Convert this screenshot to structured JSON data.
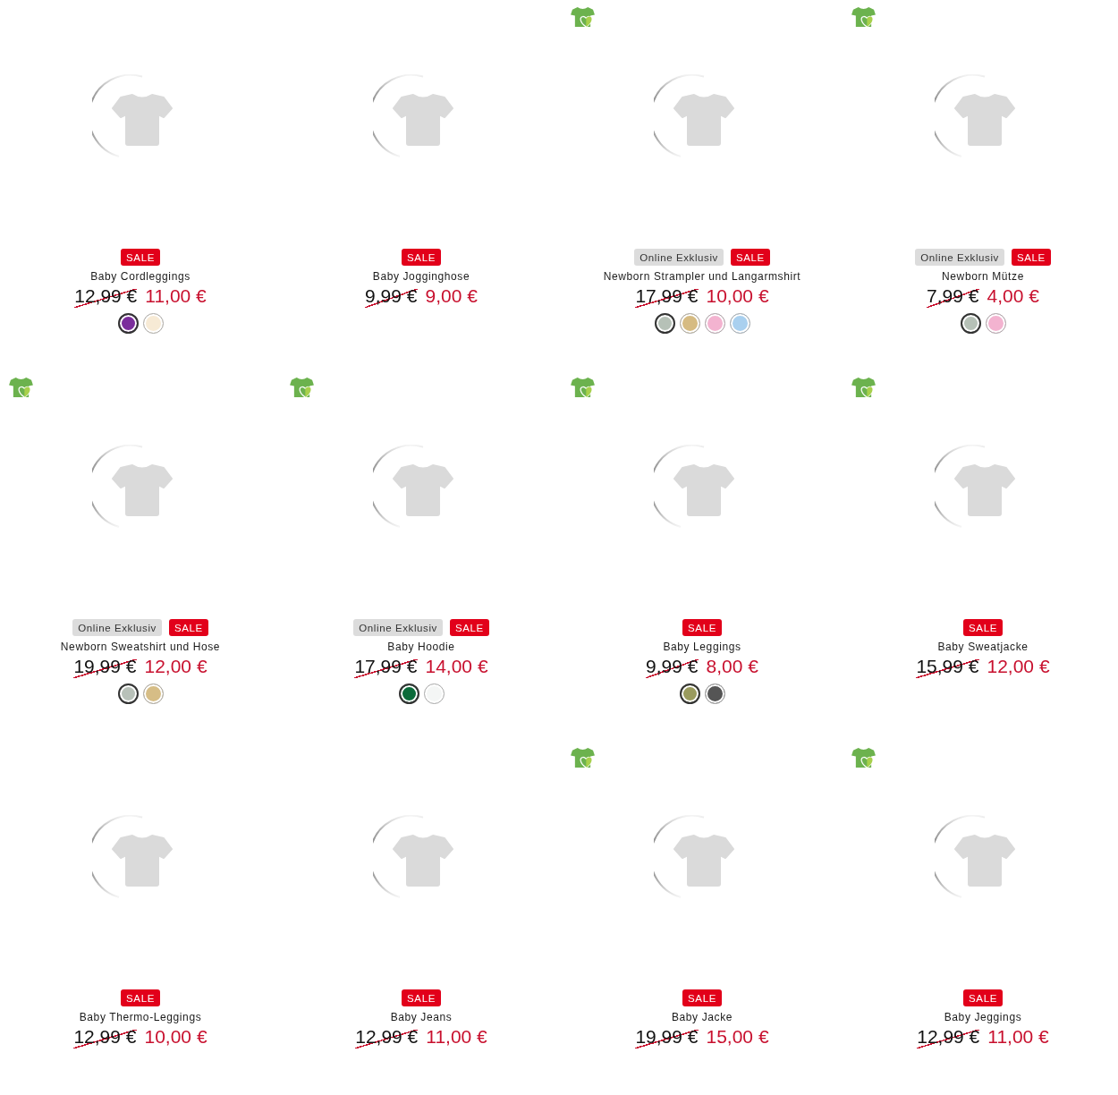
{
  "products": [
    {
      "eco": false,
      "badges": [
        {
          "kind": "sale",
          "label": "SALE"
        }
      ],
      "name": "Baby Cordleggings",
      "old_price": "12,99 €",
      "price": "11,00 €",
      "swatches": [
        {
          "color": "#7b2d9c",
          "selected": true
        },
        {
          "color": "#f7ead5",
          "selected": false
        }
      ]
    },
    {
      "eco": false,
      "badges": [
        {
          "kind": "sale",
          "label": "SALE"
        }
      ],
      "name": "Baby Jogginghose",
      "old_price": "9,99 €",
      "price": "9,00 €"
    },
    {
      "eco": true,
      "badges": [
        {
          "kind": "online",
          "label": "Online Exklusiv"
        },
        {
          "kind": "sale",
          "label": "SALE"
        }
      ],
      "name": "Newborn Strampler und Langarmshirt",
      "old_price": "17,99 €",
      "price": "10,00 €",
      "swatches": [
        {
          "color": "#b6c1b7",
          "selected": true
        },
        {
          "color": "#d6bb82",
          "selected": false
        },
        {
          "color": "#f3b3d0",
          "selected": false
        },
        {
          "color": "#a9d0ef",
          "selected": false
        }
      ]
    },
    {
      "eco": true,
      "badges": [
        {
          "kind": "online",
          "label": "Online Exklusiv"
        },
        {
          "kind": "sale",
          "label": "SALE"
        }
      ],
      "name": "Newborn Mütze",
      "old_price": "7,99 €",
      "price": "4,00 €",
      "swatches": [
        {
          "color": "#b6c1b7",
          "selected": true
        },
        {
          "color": "#f3b3d0",
          "selected": false
        }
      ]
    },
    {
      "eco": true,
      "badges": [
        {
          "kind": "online",
          "label": "Online Exklusiv"
        },
        {
          "kind": "sale",
          "label": "SALE"
        }
      ],
      "name": "Newborn Sweatshirt und Hose",
      "old_price": "19,99 €",
      "price": "12,00 €",
      "swatches": [
        {
          "color": "#b8c1b9",
          "selected": true
        },
        {
          "color": "#d6bd86",
          "selected": false
        }
      ]
    },
    {
      "eco": true,
      "badges": [
        {
          "kind": "online",
          "label": "Online Exklusiv"
        },
        {
          "kind": "sale",
          "label": "SALE"
        }
      ],
      "name": "Baby Hoodie",
      "old_price": "17,99 €",
      "price": "14,00 €",
      "swatches": [
        {
          "color": "#0b6b3a",
          "selected": true
        },
        {
          "color": "#f4f6f5",
          "selected": false
        }
      ]
    },
    {
      "eco": true,
      "badges": [
        {
          "kind": "sale",
          "label": "SALE"
        }
      ],
      "name": "Baby Leggings",
      "old_price": "9,99 €",
      "price": "8,00 €",
      "swatches": [
        {
          "color": "#9a9b5d",
          "selected": true
        },
        {
          "color": "#555555",
          "selected": false
        }
      ]
    },
    {
      "eco": true,
      "badges": [
        {
          "kind": "sale",
          "label": "SALE"
        }
      ],
      "name": "Baby Sweatjacke",
      "old_price": "15,99 €",
      "price": "12,00 €"
    },
    {
      "eco": false,
      "badges": [
        {
          "kind": "sale",
          "label": "SALE"
        }
      ],
      "name": "Baby Thermo-Leggings",
      "old_price": "12,99 €",
      "price": "10,00 €"
    },
    {
      "eco": false,
      "badges": [
        {
          "kind": "sale",
          "label": "SALE"
        }
      ],
      "name": "Baby Jeans",
      "old_price": "12,99 €",
      "price": "11,00 €"
    },
    {
      "eco": true,
      "badges": [
        {
          "kind": "sale",
          "label": "SALE"
        }
      ],
      "name": "Baby Jacke",
      "old_price": "19,99 €",
      "price": "15,00 €"
    },
    {
      "eco": true,
      "badges": [
        {
          "kind": "sale",
          "label": "SALE"
        }
      ],
      "name": "Baby Jeggings",
      "old_price": "12,99 €",
      "price": "11,00 €"
    }
  ]
}
